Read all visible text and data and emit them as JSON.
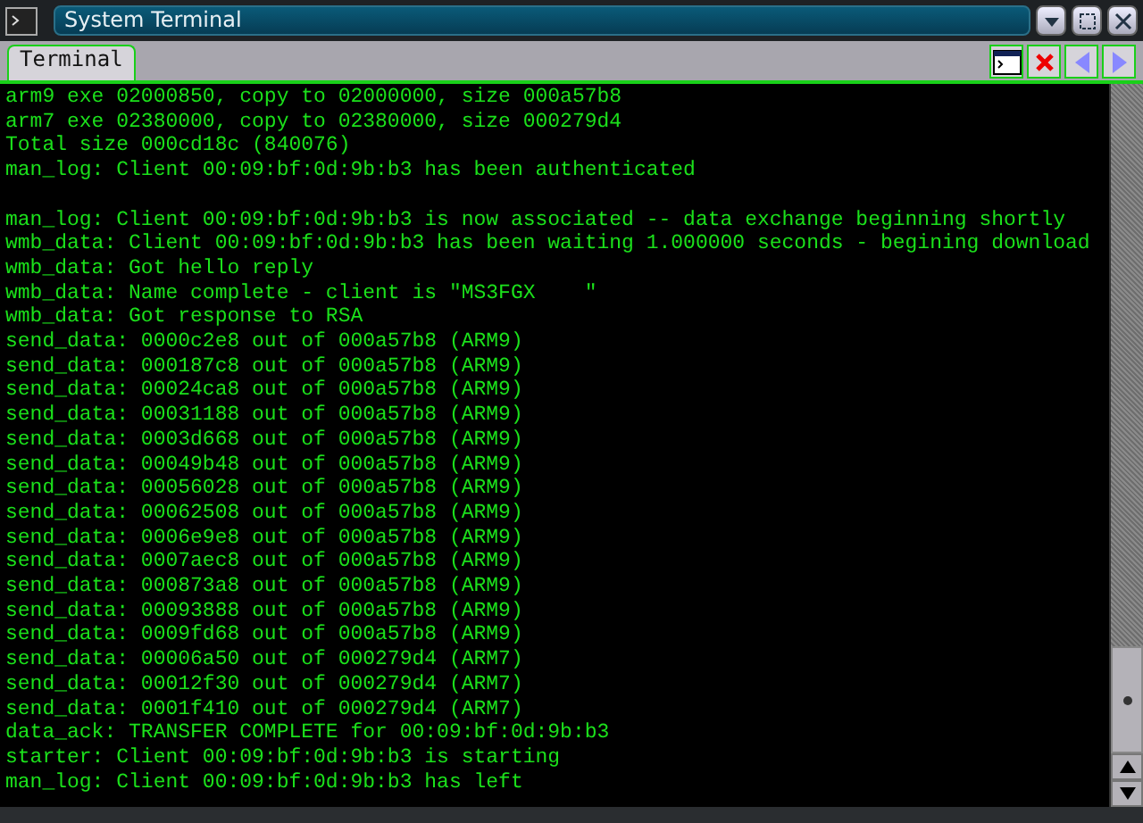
{
  "window": {
    "title": "System Terminal"
  },
  "tabs": [
    {
      "label": "Terminal",
      "selected": true
    }
  ],
  "lines": [
    {
      "kind": "text",
      "text": "arm9 exe 02000850, copy to 02000000, size 000a57b8"
    },
    {
      "kind": "text",
      "text": "arm7 exe 02380000, copy to 02380000, size 000279d4"
    },
    {
      "kind": "text",
      "text": "Total size 000cd18c (840076)"
    },
    {
      "kind": "text",
      "text": "man_log: Client 00:09:bf:0d:9b:b3 has been authenticated"
    },
    {
      "kind": "blank"
    },
    {
      "kind": "text",
      "text": "man_log: Client 00:09:bf:0d:9b:b3 is now associated -- data exchange beginning shortly"
    },
    {
      "kind": "text",
      "text": "wmb_data: Client 00:09:bf:0d:9b:b3 has been waiting 1.000000 seconds - begining download"
    },
    {
      "kind": "text",
      "text": "wmb_data: Got hello reply"
    },
    {
      "kind": "text",
      "text": "wmb_data: Name complete - client is \"MS3FGX    \""
    },
    {
      "kind": "text",
      "text": "wmb_data: Got response to RSA"
    },
    {
      "kind": "text",
      "text": "send_data: 0000c2e8 out of 000a57b8 (ARM9)"
    },
    {
      "kind": "text",
      "text": "send_data: 000187c8 out of 000a57b8 (ARM9)"
    },
    {
      "kind": "text",
      "text": "send_data: 00024ca8 out of 000a57b8 (ARM9)"
    },
    {
      "kind": "text",
      "text": "send_data: 00031188 out of 000a57b8 (ARM9)"
    },
    {
      "kind": "text",
      "text": "send_data: 0003d668 out of 000a57b8 (ARM9)"
    },
    {
      "kind": "text",
      "text": "send_data: 00049b48 out of 000a57b8 (ARM9)"
    },
    {
      "kind": "text",
      "text": "send_data: 00056028 out of 000a57b8 (ARM9)"
    },
    {
      "kind": "text",
      "text": "send_data: 00062508 out of 000a57b8 (ARM9)"
    },
    {
      "kind": "text",
      "text": "send_data: 0006e9e8 out of 000a57b8 (ARM9)"
    },
    {
      "kind": "text",
      "text": "send_data: 0007aec8 out of 000a57b8 (ARM9)"
    },
    {
      "kind": "text",
      "text": "send_data: 000873a8 out of 000a57b8 (ARM9)"
    },
    {
      "kind": "text",
      "text": "send_data: 00093888 out of 000a57b8 (ARM9)"
    },
    {
      "kind": "text",
      "text": "send_data: 0009fd68 out of 000a57b8 (ARM9)"
    },
    {
      "kind": "text",
      "text": "send_data: 00006a50 out of 000279d4 (ARM7)"
    },
    {
      "kind": "text",
      "text": "send_data: 00012f30 out of 000279d4 (ARM7)"
    },
    {
      "kind": "text",
      "text": "send_data: 0001f410 out of 000279d4 (ARM7)"
    },
    {
      "kind": "text",
      "text": "data_ack: TRANSFER COMPLETE for 00:09:bf:0d:9b:b3"
    },
    {
      "kind": "text",
      "text": "starter: Client 00:09:bf:0d:9b:b3 is starting"
    },
    {
      "kind": "text",
      "text": "man_log: Client 00:09:bf:0d:9b:b3 has left"
    }
  ]
}
